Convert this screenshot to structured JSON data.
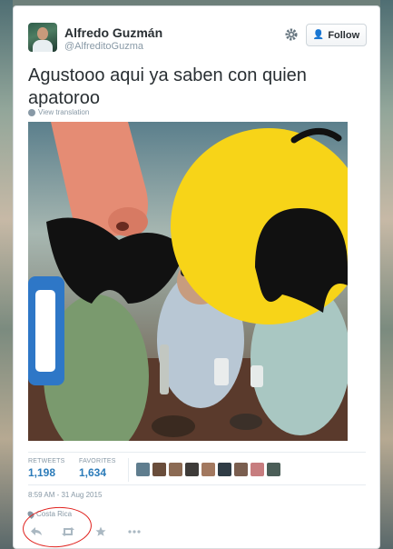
{
  "user": {
    "name": "Alfredo Guzmán",
    "handle": "@AlfreditoGuzma"
  },
  "actions": {
    "follow_label": "Follow",
    "settings_icon": "gear-icon",
    "follow_icon": "add-user-icon"
  },
  "tweet": {
    "text": "Agustooo aqui ya saben con quien apatoroo",
    "translate_label": "View translation",
    "timestamp": "8:59 AM - 31 Aug 2015",
    "location": "Costa Rica"
  },
  "stats": {
    "retweets_label": "RETWEETS",
    "retweets_value": "1,198",
    "favorites_label": "FAVORITES",
    "favorites_value": "1,634"
  },
  "favoriters": [
    {
      "icon": "avatar"
    },
    {
      "icon": "avatar"
    },
    {
      "icon": "avatar"
    },
    {
      "icon": "avatar"
    },
    {
      "icon": "avatar"
    },
    {
      "icon": "avatar"
    },
    {
      "icon": "avatar"
    },
    {
      "icon": "avatar"
    },
    {
      "icon": "avatar"
    }
  ],
  "footer_actions": [
    "reply-icon",
    "retweet-icon",
    "favorite-icon",
    "more-icon"
  ],
  "colors": {
    "link_blue": "#2b7bb9",
    "muted": "#8899a6",
    "emoji_yellow": "#f7d418",
    "annotation_red": "#e0201c"
  }
}
